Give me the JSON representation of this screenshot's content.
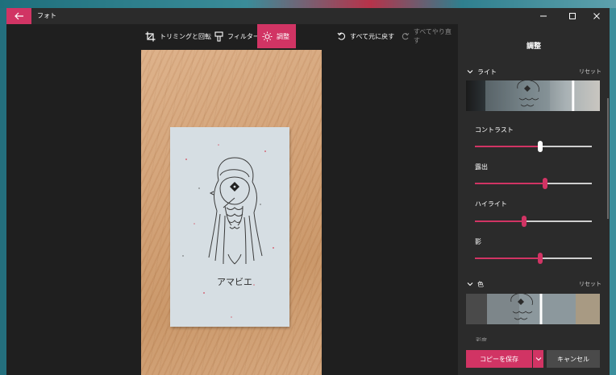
{
  "window": {
    "title": "フォト",
    "accent": "#d13464"
  },
  "icons": {
    "back": "arrow-left-icon",
    "minimize": "minimize-icon",
    "maximize": "maximize-icon",
    "close": "close-icon",
    "crop": "crop-rotate-icon",
    "filter": "filter-icon",
    "adjust": "sun-icon",
    "undo": "undo-icon",
    "redo": "redo-icon",
    "chevron": "chevron-down-icon"
  },
  "toolbar": {
    "crop_label": "トリミングと回転",
    "filter_label": "フィルター",
    "adjust_label": "調整",
    "undo_label": "すべて元に戻す",
    "redo_label": "すべてやり直す"
  },
  "photo": {
    "card_caption": "アマビエ"
  },
  "panel": {
    "title": "調整",
    "light": {
      "label": "ライト",
      "reset": "リセット",
      "strip_marker": 0.8
    },
    "sliders": [
      {
        "label": "コントラスト",
        "value": 0.56
      },
      {
        "label": "露出",
        "value": 0.6
      },
      {
        "label": "ハイライト",
        "value": 0.42
      },
      {
        "label": "影",
        "value": 0.56
      }
    ],
    "color": {
      "label": "色",
      "reset": "リセット",
      "strip_marker": 0.56
    },
    "cut_label": "彩度",
    "save_label": "コピーを保存",
    "cancel_label": "キャンセル"
  }
}
